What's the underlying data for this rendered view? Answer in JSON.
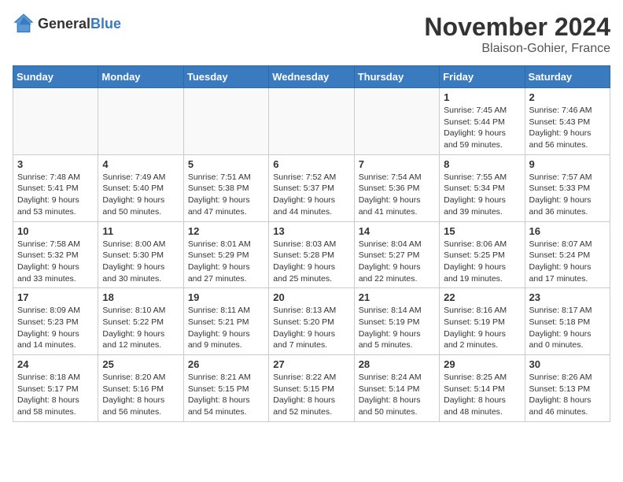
{
  "header": {
    "logo_general": "General",
    "logo_blue": "Blue",
    "month_title": "November 2024",
    "location": "Blaison-Gohier, France"
  },
  "weekdays": [
    "Sunday",
    "Monday",
    "Tuesday",
    "Wednesday",
    "Thursday",
    "Friday",
    "Saturday"
  ],
  "weeks": [
    [
      {
        "day": "",
        "info": ""
      },
      {
        "day": "",
        "info": ""
      },
      {
        "day": "",
        "info": ""
      },
      {
        "day": "",
        "info": ""
      },
      {
        "day": "",
        "info": ""
      },
      {
        "day": "1",
        "info": "Sunrise: 7:45 AM\nSunset: 5:44 PM\nDaylight: 9 hours and 59 minutes."
      },
      {
        "day": "2",
        "info": "Sunrise: 7:46 AM\nSunset: 5:43 PM\nDaylight: 9 hours and 56 minutes."
      }
    ],
    [
      {
        "day": "3",
        "info": "Sunrise: 7:48 AM\nSunset: 5:41 PM\nDaylight: 9 hours and 53 minutes."
      },
      {
        "day": "4",
        "info": "Sunrise: 7:49 AM\nSunset: 5:40 PM\nDaylight: 9 hours and 50 minutes."
      },
      {
        "day": "5",
        "info": "Sunrise: 7:51 AM\nSunset: 5:38 PM\nDaylight: 9 hours and 47 minutes."
      },
      {
        "day": "6",
        "info": "Sunrise: 7:52 AM\nSunset: 5:37 PM\nDaylight: 9 hours and 44 minutes."
      },
      {
        "day": "7",
        "info": "Sunrise: 7:54 AM\nSunset: 5:36 PM\nDaylight: 9 hours and 41 minutes."
      },
      {
        "day": "8",
        "info": "Sunrise: 7:55 AM\nSunset: 5:34 PM\nDaylight: 9 hours and 39 minutes."
      },
      {
        "day": "9",
        "info": "Sunrise: 7:57 AM\nSunset: 5:33 PM\nDaylight: 9 hours and 36 minutes."
      }
    ],
    [
      {
        "day": "10",
        "info": "Sunrise: 7:58 AM\nSunset: 5:32 PM\nDaylight: 9 hours and 33 minutes."
      },
      {
        "day": "11",
        "info": "Sunrise: 8:00 AM\nSunset: 5:30 PM\nDaylight: 9 hours and 30 minutes."
      },
      {
        "day": "12",
        "info": "Sunrise: 8:01 AM\nSunset: 5:29 PM\nDaylight: 9 hours and 27 minutes."
      },
      {
        "day": "13",
        "info": "Sunrise: 8:03 AM\nSunset: 5:28 PM\nDaylight: 9 hours and 25 minutes."
      },
      {
        "day": "14",
        "info": "Sunrise: 8:04 AM\nSunset: 5:27 PM\nDaylight: 9 hours and 22 minutes."
      },
      {
        "day": "15",
        "info": "Sunrise: 8:06 AM\nSunset: 5:25 PM\nDaylight: 9 hours and 19 minutes."
      },
      {
        "day": "16",
        "info": "Sunrise: 8:07 AM\nSunset: 5:24 PM\nDaylight: 9 hours and 17 minutes."
      }
    ],
    [
      {
        "day": "17",
        "info": "Sunrise: 8:09 AM\nSunset: 5:23 PM\nDaylight: 9 hours and 14 minutes."
      },
      {
        "day": "18",
        "info": "Sunrise: 8:10 AM\nSunset: 5:22 PM\nDaylight: 9 hours and 12 minutes."
      },
      {
        "day": "19",
        "info": "Sunrise: 8:11 AM\nSunset: 5:21 PM\nDaylight: 9 hours and 9 minutes."
      },
      {
        "day": "20",
        "info": "Sunrise: 8:13 AM\nSunset: 5:20 PM\nDaylight: 9 hours and 7 minutes."
      },
      {
        "day": "21",
        "info": "Sunrise: 8:14 AM\nSunset: 5:19 PM\nDaylight: 9 hours and 5 minutes."
      },
      {
        "day": "22",
        "info": "Sunrise: 8:16 AM\nSunset: 5:19 PM\nDaylight: 9 hours and 2 minutes."
      },
      {
        "day": "23",
        "info": "Sunrise: 8:17 AM\nSunset: 5:18 PM\nDaylight: 9 hours and 0 minutes."
      }
    ],
    [
      {
        "day": "24",
        "info": "Sunrise: 8:18 AM\nSunset: 5:17 PM\nDaylight: 8 hours and 58 minutes."
      },
      {
        "day": "25",
        "info": "Sunrise: 8:20 AM\nSunset: 5:16 PM\nDaylight: 8 hours and 56 minutes."
      },
      {
        "day": "26",
        "info": "Sunrise: 8:21 AM\nSunset: 5:15 PM\nDaylight: 8 hours and 54 minutes."
      },
      {
        "day": "27",
        "info": "Sunrise: 8:22 AM\nSunset: 5:15 PM\nDaylight: 8 hours and 52 minutes."
      },
      {
        "day": "28",
        "info": "Sunrise: 8:24 AM\nSunset: 5:14 PM\nDaylight: 8 hours and 50 minutes."
      },
      {
        "day": "29",
        "info": "Sunrise: 8:25 AM\nSunset: 5:14 PM\nDaylight: 8 hours and 48 minutes."
      },
      {
        "day": "30",
        "info": "Sunrise: 8:26 AM\nSunset: 5:13 PM\nDaylight: 8 hours and 46 minutes."
      }
    ]
  ]
}
